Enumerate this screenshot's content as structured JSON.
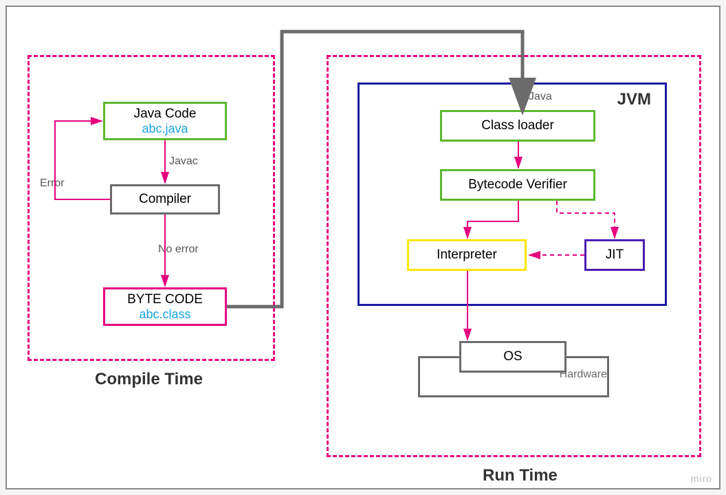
{
  "compileTime": {
    "title": "Compile Time",
    "javaCode": {
      "label": "Java Code",
      "file": "abc.java"
    },
    "javacLabel": "Javac",
    "compiler": "Compiler",
    "errorLabel": "Error",
    "noErrorLabel": "No error",
    "byteCode": {
      "label": "BYTE CODE",
      "file": "abc.class"
    }
  },
  "runtime": {
    "title": "Run Time",
    "jvmLabel": "JVM",
    "javaLabel": "Java",
    "classLoader": "Class loader",
    "verifier": "Bytecode Verifier",
    "interpreter": "Interpreter",
    "jit": "JIT",
    "os": "OS",
    "hardware": "Hardware"
  },
  "watermark": "miro",
  "arrows": {
    "javacodeToCompiler": {
      "color": "#e6007e"
    },
    "compilerToBytecode": {
      "color": "#e6007e"
    },
    "errorLoop": {
      "color": "#e6007e"
    },
    "bytecodeToJvm": {
      "color": "#6b6b6b",
      "thick": true
    },
    "classloaderToVerifier": {
      "color": "#e6007e"
    },
    "verifierToInterpreter": {
      "color": "#e6007e"
    },
    "verifierToJit": {
      "color": "#e6007e",
      "dashed": true
    },
    "jitToInterpreter": {
      "color": "#e6007e",
      "dashed": true
    },
    "interpreterToOs": {
      "color": "#e6007e"
    }
  }
}
